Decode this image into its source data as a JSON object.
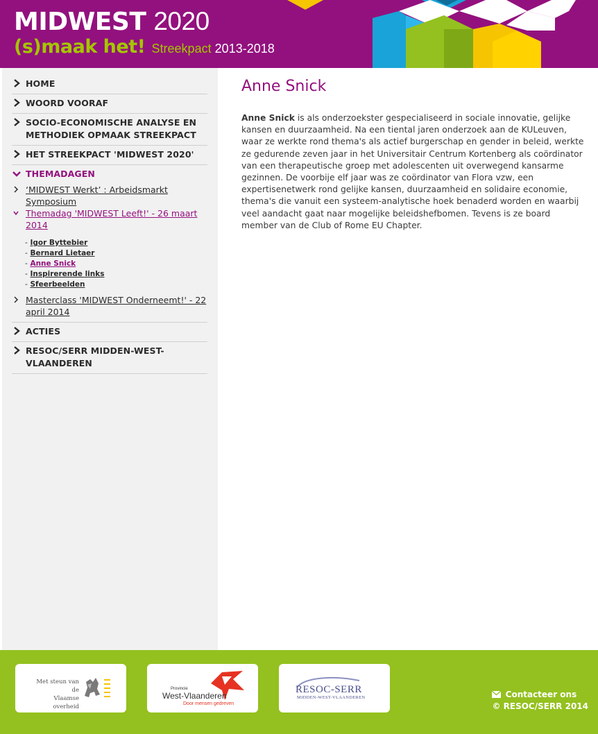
{
  "header": {
    "title_bold": "MIDWEST",
    "title_year": "2020",
    "slogan": "(s)maak het!",
    "streekpact": "Streekpact",
    "years": "2013-2018"
  },
  "nav": {
    "items": [
      {
        "label": "HOME"
      },
      {
        "label": "WOORD VOORAF"
      },
      {
        "label": "SOCIO-ECONOMISCHE ANALYSE EN METHODIEK OPMAAK STREEKPACT"
      },
      {
        "label": "HET STREEKPACT 'MIDWEST 2020'"
      },
      {
        "label": "THEMADAGEN"
      },
      {
        "label": "ACTIES"
      },
      {
        "label": "RESOC/SERR MIDDEN-WEST-VLAANDEREN"
      }
    ],
    "themadagen": [
      {
        "label": "‘MIDWEST Werkt’ : Arbeidsmarkt Symposium"
      },
      {
        "label": "Themadag 'MIDWEST Leeft!' - 26 maart 2014"
      },
      {
        "label": "Masterclass 'MIDWEST Onderneemt!' - 22 april 2014"
      }
    ],
    "leeft_children": [
      {
        "label": "Igor Byttebier"
      },
      {
        "label": "Bernard Lietaer"
      },
      {
        "label": "Anne Snick"
      },
      {
        "label": "Inspirerende links"
      },
      {
        "label": "Sfeerbeelden"
      }
    ],
    "dash": "-"
  },
  "main": {
    "title": "Anne Snick",
    "bio_name": "Anne Snick",
    "bio_text": " is als onderzoekster gespecialiseerd in sociale innovatie, gelijke kansen en duurzaamheid. Na een tiental jaren onderzoek aan de KULeuven, waar ze werkte rond thema's als actief burgerschap en gender in beleid, werkte ze gedurende zeven jaar in het Universitair Centrum Kortenberg als coördinator van een therapeutische groep met adolescenten uit overwegend kansarme gezinnen. De voorbije elf jaar was ze coördinator van Flora vzw, een expertisenetwerk rond gelijke kansen, duurzaamheid en solidaire economie, thema's die vanuit een systeem-analytische hoek benaderd worden en waarbij veel aandacht gaat naar mogelijke beleidshefbomen. Tevens is ze board member van de Club of Rome EU Chapter."
  },
  "footer": {
    "logo1_line1": "Met steun van de",
    "logo1_line2": "Vlaamse overheid",
    "logo2_small": "Provincie",
    "logo2_name": "West-Vlaanderen",
    "logo2_tag": "Door mensen gedreven",
    "logo3_name": "RESOC-SERR",
    "logo3_sub": "MIDDEN-WEST-VLAANDEREN",
    "contact": "Contacteer ons",
    "copyright": "© RESOC/SERR 2014"
  },
  "colors": {
    "brand_purple": "#93117e",
    "brand_green": "#94c11f",
    "sidebar_bg": "#f1f1f1"
  },
  "icons": [
    "chevron-right-icon",
    "chevron-down-icon",
    "envelope-icon",
    "lion-icon",
    "flag-icon"
  ]
}
